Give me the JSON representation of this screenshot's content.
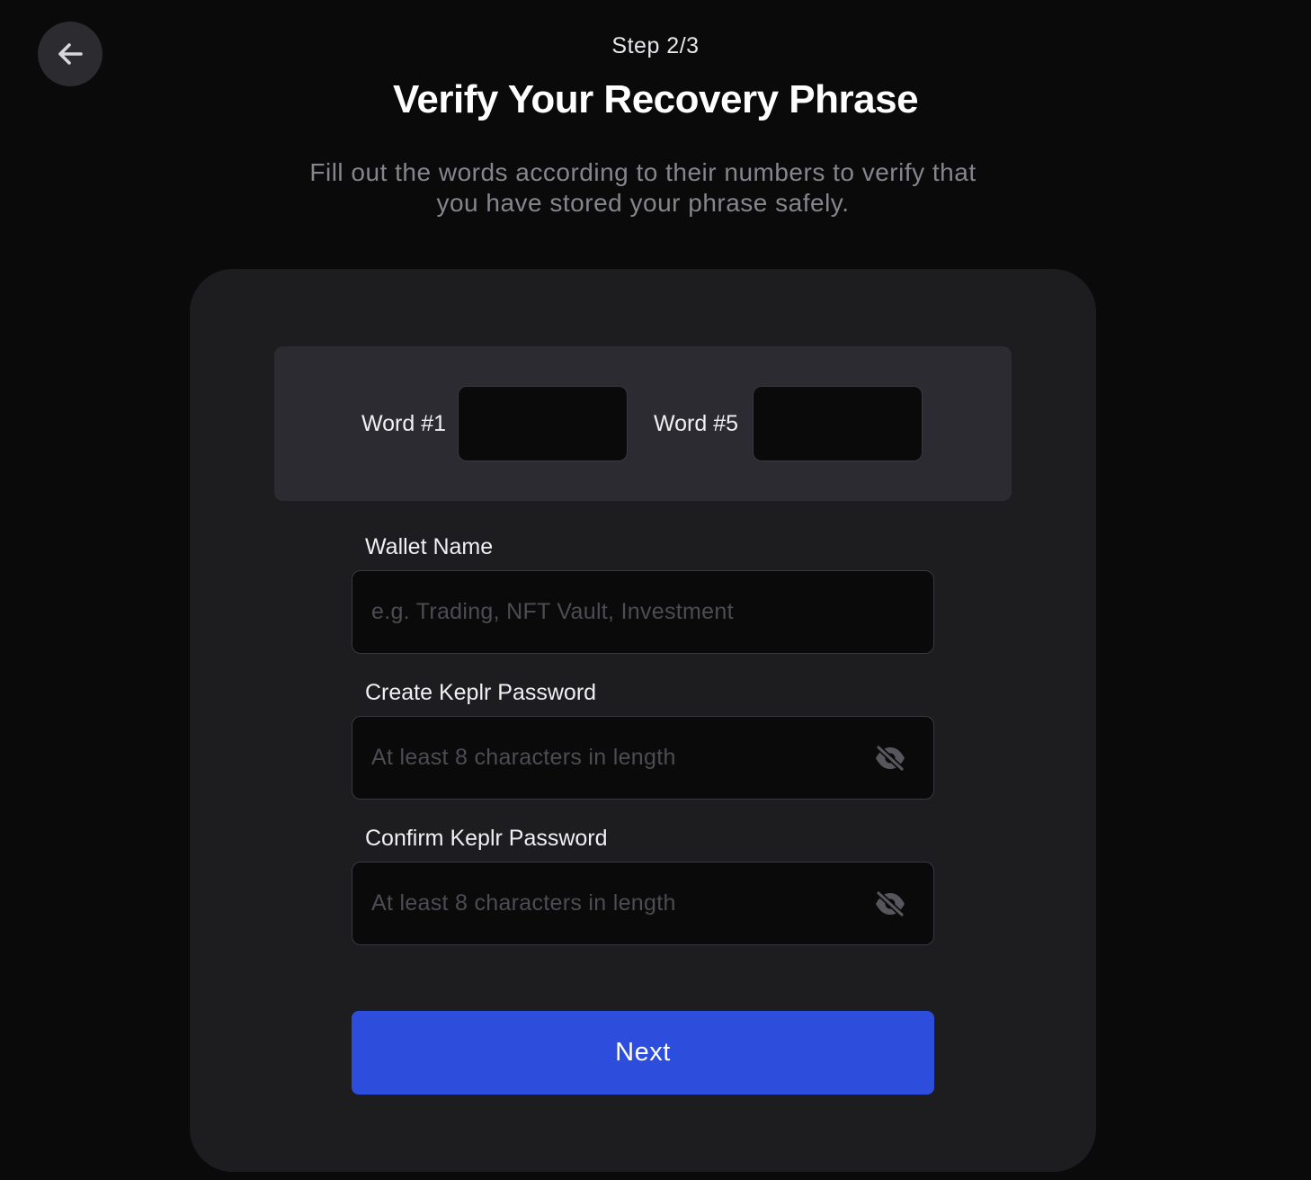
{
  "header": {
    "back_button_icon": "arrow-left-icon",
    "step": "Step 2/3",
    "title": "Verify Your Recovery Phrase",
    "subtitle_line1": "Fill out the words according to their numbers to verify that",
    "subtitle_line2": "you have stored your phrase safely."
  },
  "verify_words": [
    {
      "label": "Word #1",
      "value": ""
    },
    {
      "label": "Word #5",
      "value": ""
    }
  ],
  "form": {
    "wallet_name": {
      "label": "Wallet Name",
      "placeholder": "e.g. Trading, NFT Vault, Investment",
      "value": ""
    },
    "password": {
      "label": "Create Keplr Password",
      "placeholder": "At least 8 characters in length",
      "value": "",
      "toggle_icon": "eye-slash-icon"
    },
    "confirm_password": {
      "label": "Confirm Keplr Password",
      "placeholder": "At least 8 characters in length",
      "value": "",
      "toggle_icon": "eye-slash-icon"
    },
    "next_label": "Next"
  },
  "colors": {
    "background": "#0a0a0b",
    "card": "#1d1d20",
    "panel": "#2b2b31",
    "input": "#0a0a0b",
    "accent": "#2d4ddc",
    "muted_text": "#85858c"
  }
}
